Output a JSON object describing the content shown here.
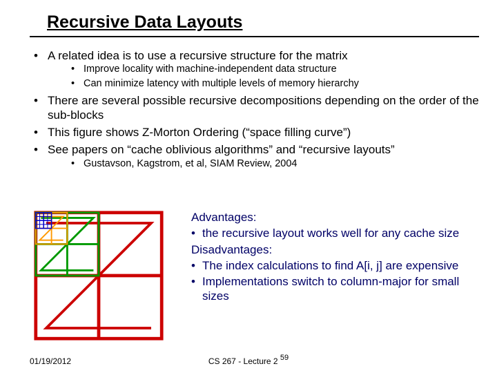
{
  "title": "Recursive Data Layouts",
  "bullets": {
    "b0": "A related idea is to use a recursive structure for the matrix",
    "b0_sub0": "Improve locality with machine-independent data structure",
    "b0_sub1": "Can minimize latency with multiple levels of memory hierarchy",
    "b1": "There are several possible recursive decompositions depending on the order of the sub-blocks",
    "b2": "This figure shows Z-Morton Ordering (“space filling curve”)",
    "b3": "See papers on “cache oblivious algorithms” and “recursive layouts”",
    "b3_sub0": "Gustavson, Kagstrom, et al, SIAM Review, 2004"
  },
  "right": {
    "adv_hdr": "Advantages:",
    "adv_0": "the recursive layout works well for any cache size",
    "dis_hdr": "Disadvantages:",
    "dis_0": "The index calculations to find A[i, j] are expensive",
    "dis_1": "Implementations switch to column-major for small sizes"
  },
  "footer": {
    "date": "01/19/2012",
    "center": "CS 267 - Lecture 2",
    "page": "59"
  }
}
